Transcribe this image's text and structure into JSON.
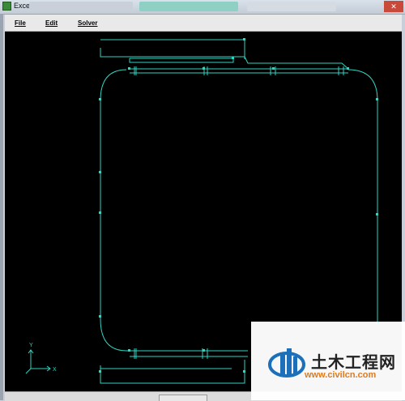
{
  "window": {
    "title": "Exceed",
    "colors": {
      "line": "#2fd5c0",
      "canvas": "#000000",
      "titlebar": "#d9e1ea"
    }
  },
  "menu": {
    "file": "File",
    "edit": "Edit",
    "solver": "Solver"
  },
  "axis": {
    "x_label": "X",
    "y_label": "Y"
  },
  "watermark": {
    "cn_text": "土木工程网",
    "url": "www.civilcn.com"
  }
}
